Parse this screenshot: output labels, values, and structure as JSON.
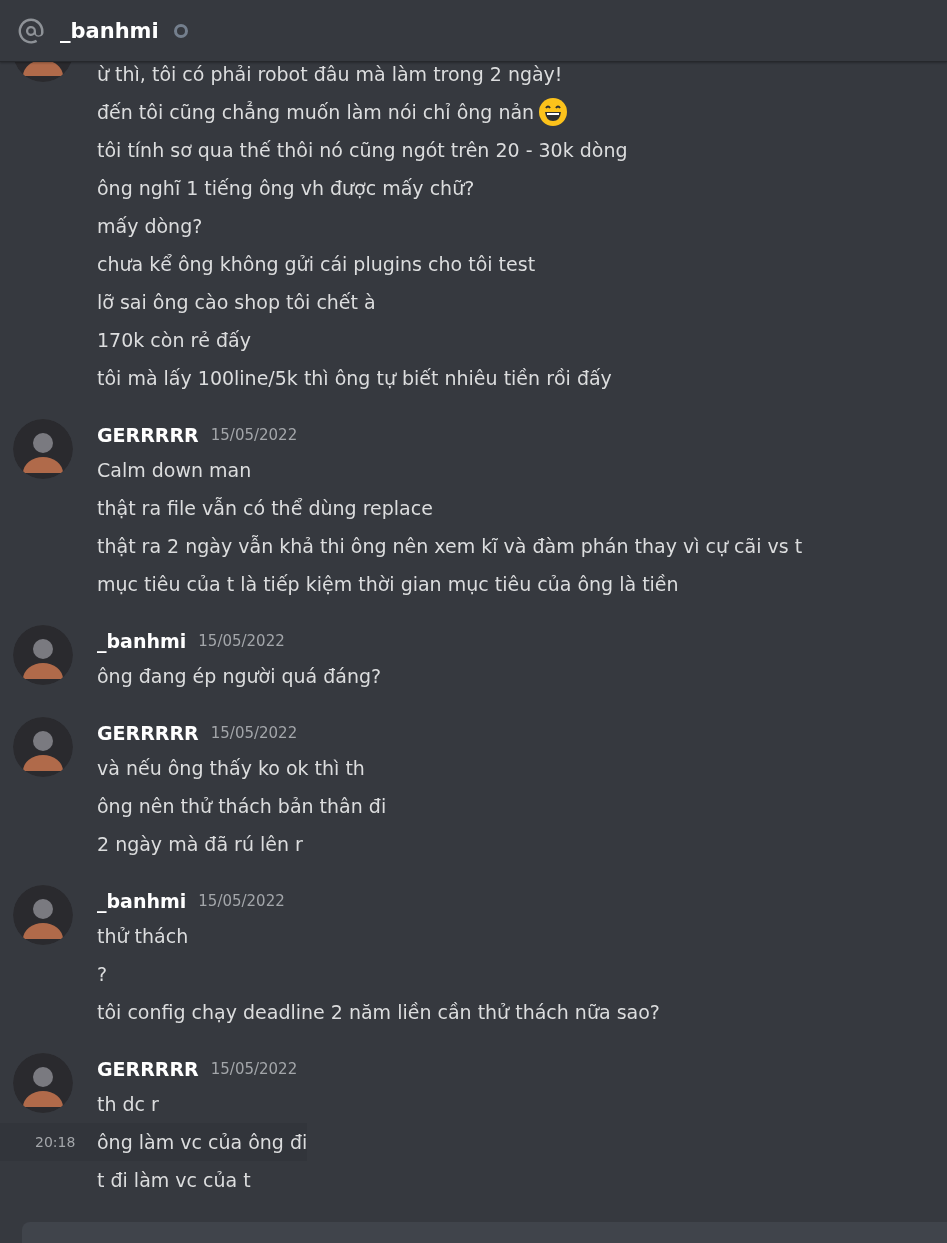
{
  "header": {
    "title": "_banhmi",
    "online": false
  },
  "groups": [
    {
      "kind": "continued",
      "lines": [
        {
          "text": "ừ thì, tôi có phải robot đâu mà làm trong 2 ngày!"
        },
        {
          "text": "đến tôi cũng chẳng muốn làm nói chỉ ông nản",
          "emoji": true
        },
        {
          "text": "tôi tính sơ qua thế thôi nó cũng ngót trên 20 - 30k dòng"
        },
        {
          "text": "ông nghĩ 1 tiếng ông vh được mấy chữ?"
        },
        {
          "text": "mấy dòng?"
        },
        {
          "text": "chưa kể ông không gửi cái plugins cho tôi test"
        },
        {
          "text": "lỡ sai ông cào shop tôi chết à"
        },
        {
          "text": "170k còn rẻ đấy"
        },
        {
          "text": "tôi mà lấy 100line/5k thì ông tự biết nhiêu tiền rồi đấy"
        }
      ]
    },
    {
      "kind": "full",
      "author": "GERRRRR",
      "date": "15/05/2022",
      "lines": [
        {
          "text": "Calm down man"
        },
        {
          "text": "thật ra file vẫn có thể dùng replace"
        },
        {
          "text": "thật ra 2 ngày vẫn khả thi ông nên xem kĩ và đàm phán thay vì cự cãi vs t"
        },
        {
          "text": "mục tiêu của t là tiếp kiệm thời gian mục tiêu của ông là tiền"
        }
      ]
    },
    {
      "kind": "full",
      "author": "_banhmi",
      "date": "15/05/2022",
      "lines": [
        {
          "text": "ông đang ép người quá đáng?"
        }
      ]
    },
    {
      "kind": "full",
      "author": "GERRRRR",
      "date": "15/05/2022",
      "lines": [
        {
          "text": "và nếu ông thấy ko ok thì th"
        },
        {
          "text": "ông nên thử thách bản thân đi"
        },
        {
          "text": "2 ngày mà đã rú lên r"
        }
      ]
    },
    {
      "kind": "full",
      "author": "_banhmi",
      "date": "15/05/2022",
      "lines": [
        {
          "text": "thử thách"
        },
        {
          "text": "?"
        },
        {
          "text": "tôi config chạy deadline 2 năm liền cần thử thách nữa sao?"
        }
      ]
    },
    {
      "kind": "full",
      "author": "GERRRRR",
      "date": "15/05/2022",
      "lines": [
        {
          "text": "th dc r"
        },
        {
          "text": "ông làm vc của ông đi",
          "time": "20:18",
          "hovered": true
        },
        {
          "text": "t đi làm vc của t"
        }
      ]
    }
  ]
}
